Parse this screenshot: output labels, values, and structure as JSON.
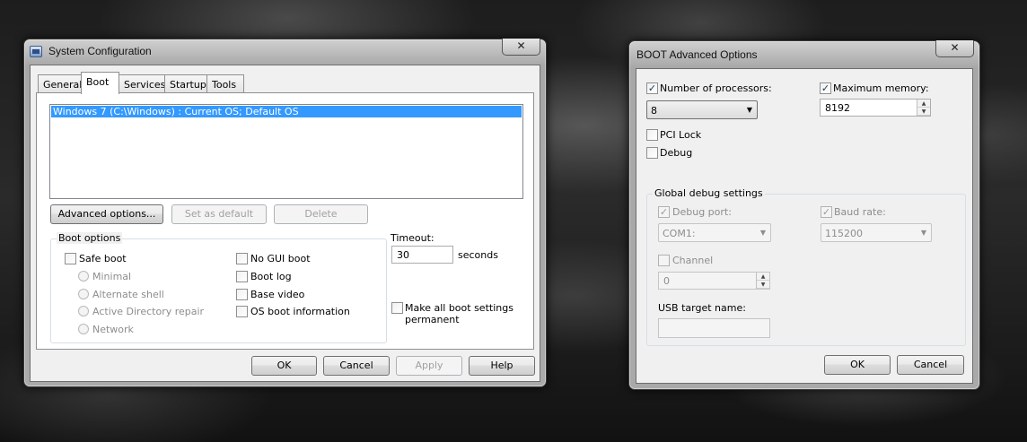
{
  "syscfg": {
    "title": "System Configuration",
    "close": "✕",
    "tabs": [
      "General",
      "Boot",
      "Services",
      "Startup",
      "Tools"
    ],
    "active_tab": "Boot",
    "os_list": [
      "Windows 7 (C:\\Windows) : Current OS; Default OS"
    ],
    "buttons": {
      "advanced": "Advanced options...",
      "set_default": "Set as default",
      "delete": "Delete"
    },
    "boot_options": {
      "label": "Boot options",
      "safe_boot": "Safe boot",
      "minimal": "Minimal",
      "alternate_shell": "Alternate shell",
      "ad_repair": "Active Directory repair",
      "network": "Network",
      "no_gui_boot": "No GUI boot",
      "boot_log": "Boot log",
      "base_video": "Base video",
      "os_boot_info": "OS boot information"
    },
    "timeout": {
      "label": "Timeout:",
      "value": "30",
      "unit": "seconds"
    },
    "permanent": {
      "line1": "Make all boot settings",
      "line2": "permanent"
    },
    "footer": {
      "ok": "OK",
      "cancel": "Cancel",
      "apply": "Apply",
      "help": "Help"
    }
  },
  "bootadv": {
    "title": "BOOT Advanced Options",
    "close": "✕",
    "num_processors": {
      "label": "Number of processors:",
      "checked": true,
      "value": "8"
    },
    "max_memory": {
      "label": "Maximum memory:",
      "checked": true,
      "value": "8192"
    },
    "pci_lock": {
      "label": "PCI Lock",
      "checked": false
    },
    "debug": {
      "label": "Debug",
      "checked": false
    },
    "global_debug": {
      "label": "Global debug settings",
      "debug_port": {
        "label": "Debug port:",
        "value": "COM1:"
      },
      "baud_rate": {
        "label": "Baud rate:",
        "value": "115200"
      },
      "channel": {
        "label": "Channel",
        "value": "0"
      },
      "usb_target": {
        "label": "USB target name:",
        "value": ""
      }
    },
    "footer": {
      "ok": "OK",
      "cancel": "Cancel"
    }
  },
  "glyphs": {
    "check": "✓",
    "down": "▼",
    "up": "▲"
  }
}
